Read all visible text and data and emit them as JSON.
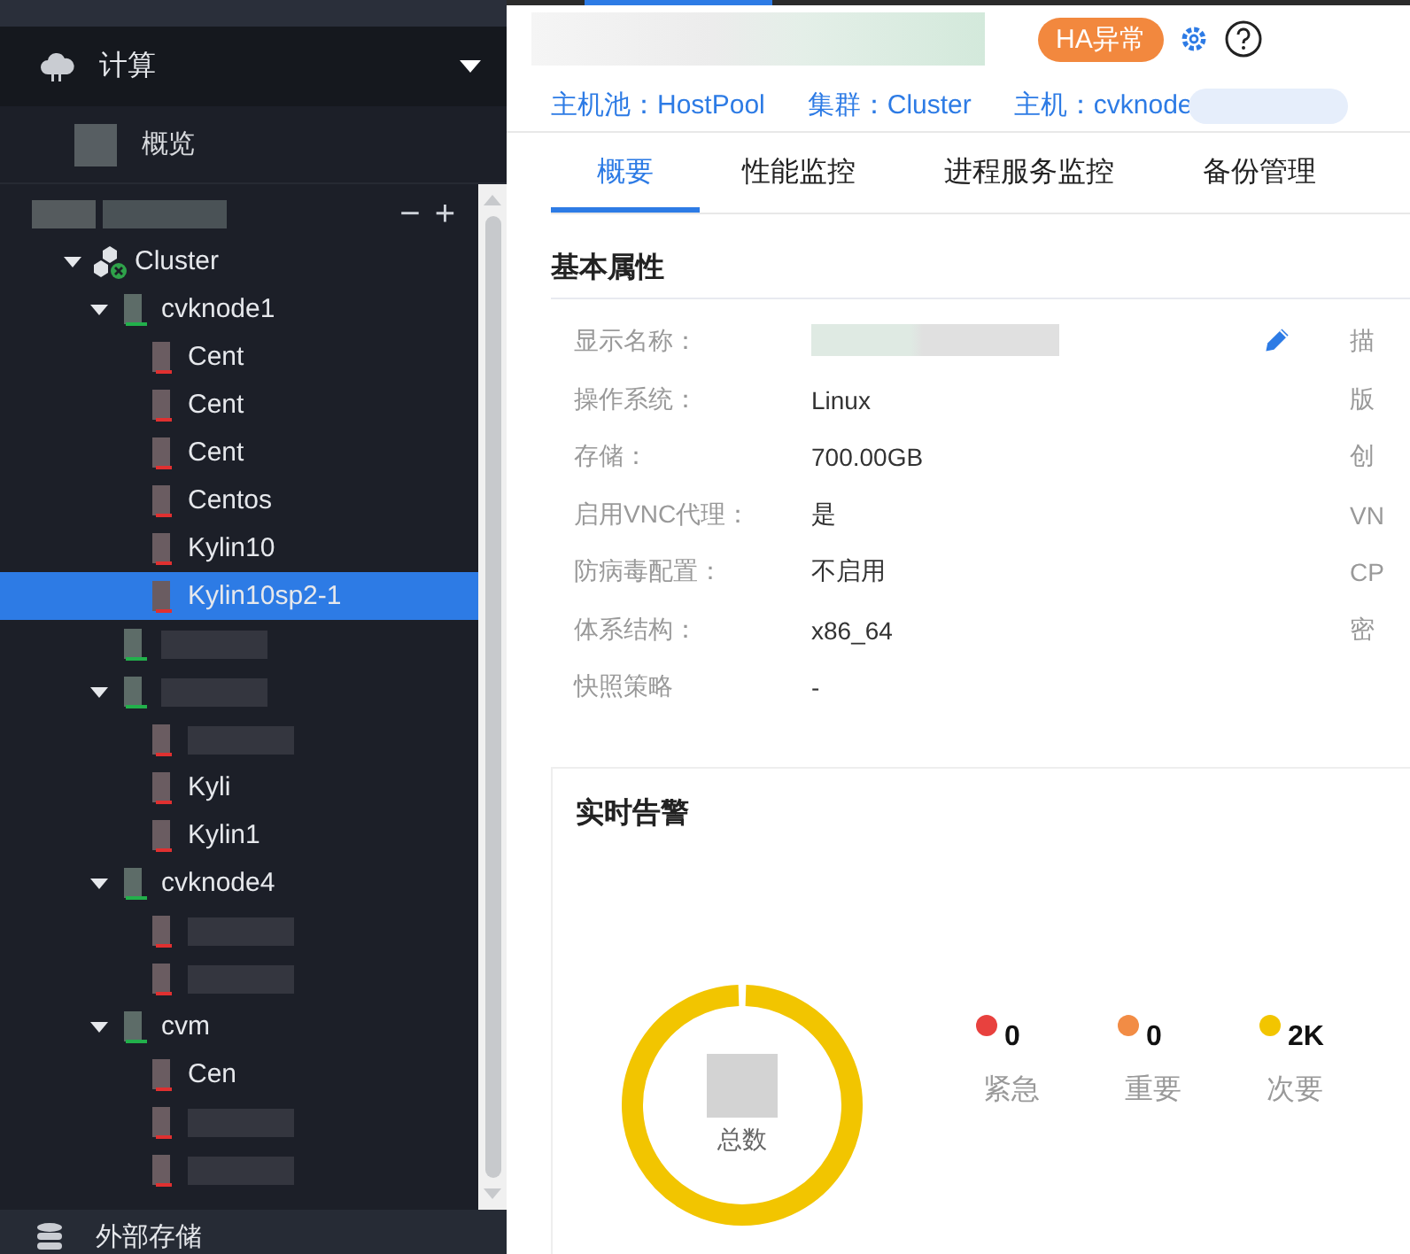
{
  "sidebar": {
    "section": "计算",
    "items": [
      {
        "label": "概览",
        "selected": false
      }
    ],
    "tree": {
      "actions": [
        "−",
        "+"
      ],
      "children": [
        {
          "label": "Cluster",
          "kind": "cluster",
          "expanded": true,
          "selected": false,
          "children": [
            {
              "label": "cvknode1",
              "kind": "host",
              "expanded": true,
              "selected": false,
              "children": [
                {
                  "label": "Cent",
                  "kind": "vm",
                  "selected": false
                },
                {
                  "label": "Cent",
                  "kind": "vm",
                  "selected": false
                },
                {
                  "label": "Cent",
                  "kind": "vm",
                  "selected": false
                },
                {
                  "label": "Centos",
                  "kind": "vm",
                  "selected": false
                },
                {
                  "label": "Kylin10",
                  "kind": "vm",
                  "selected": false
                },
                {
                  "label": "Kylin10sp2-1",
                  "kind": "vm",
                  "selected": true
                }
              ]
            },
            {
              "kind": "host",
              "selected": false
            },
            {
              "kind": "host",
              "expanded": true,
              "selected": false,
              "children": [
                {
                  "kind": "vm",
                  "selected": false
                },
                {
                  "label": "Kyli",
                  "kind": "vm",
                  "selected": false
                },
                {
                  "label": "Kylin1",
                  "kind": "vm",
                  "selected": false
                }
              ]
            },
            {
              "label": "cvknode4",
              "kind": "host",
              "expanded": true,
              "selected": false,
              "children": [
                {
                  "kind": "vm",
                  "selected": false
                },
                {
                  "kind": "vm",
                  "selected": false
                }
              ]
            },
            {
              "label": "cvm",
              "kind": "host",
              "expanded": true,
              "selected": false,
              "children": [
                {
                  "label": "Cen",
                  "kind": "vm",
                  "selected": false
                },
                {
                  "kind": "vm",
                  "selected": false
                },
                {
                  "kind": "vm",
                  "selected": false
                }
              ]
            }
          ]
        }
      ]
    },
    "footer": "外部存储"
  },
  "header": {
    "badge": "HA异常",
    "breadcrumb": [
      "主机池：HostPool",
      "集群：Cluster",
      "主机：cvknode"
    ]
  },
  "tabs": [
    {
      "label": "概要",
      "selected": true
    },
    {
      "label": "性能监控",
      "selected": false
    },
    {
      "label": "进程服务监控",
      "selected": false
    },
    {
      "label": "备份管理",
      "selected": false
    }
  ],
  "basic": {
    "title": "基本属性",
    "rows": [
      {
        "label": "显示名称：",
        "editable": true,
        "side": "描"
      },
      {
        "label": "操作系统：",
        "value": "Linux",
        "side": "版"
      },
      {
        "label": "存储：",
        "value": "700.00GB",
        "side": "创"
      },
      {
        "label": "启用VNC代理：",
        "value": "是",
        "side": "VN"
      },
      {
        "label": "防病毒配置：",
        "value": "不启用",
        "side": "CP"
      },
      {
        "label": "体系结构：",
        "value": "x86_64",
        "side": "密"
      },
      {
        "label": "快照策略",
        "value": "-"
      }
    ]
  },
  "alerts": {
    "title": "实时告警",
    "total_label": "总数",
    "levels": [
      {
        "count": "0",
        "label": "紧急",
        "color": "#e8413e"
      },
      {
        "count": "0",
        "label": "重要",
        "color": "#f28c45"
      },
      {
        "count": "2K",
        "label": "次要",
        "color": "#f2c500"
      }
    ]
  }
}
